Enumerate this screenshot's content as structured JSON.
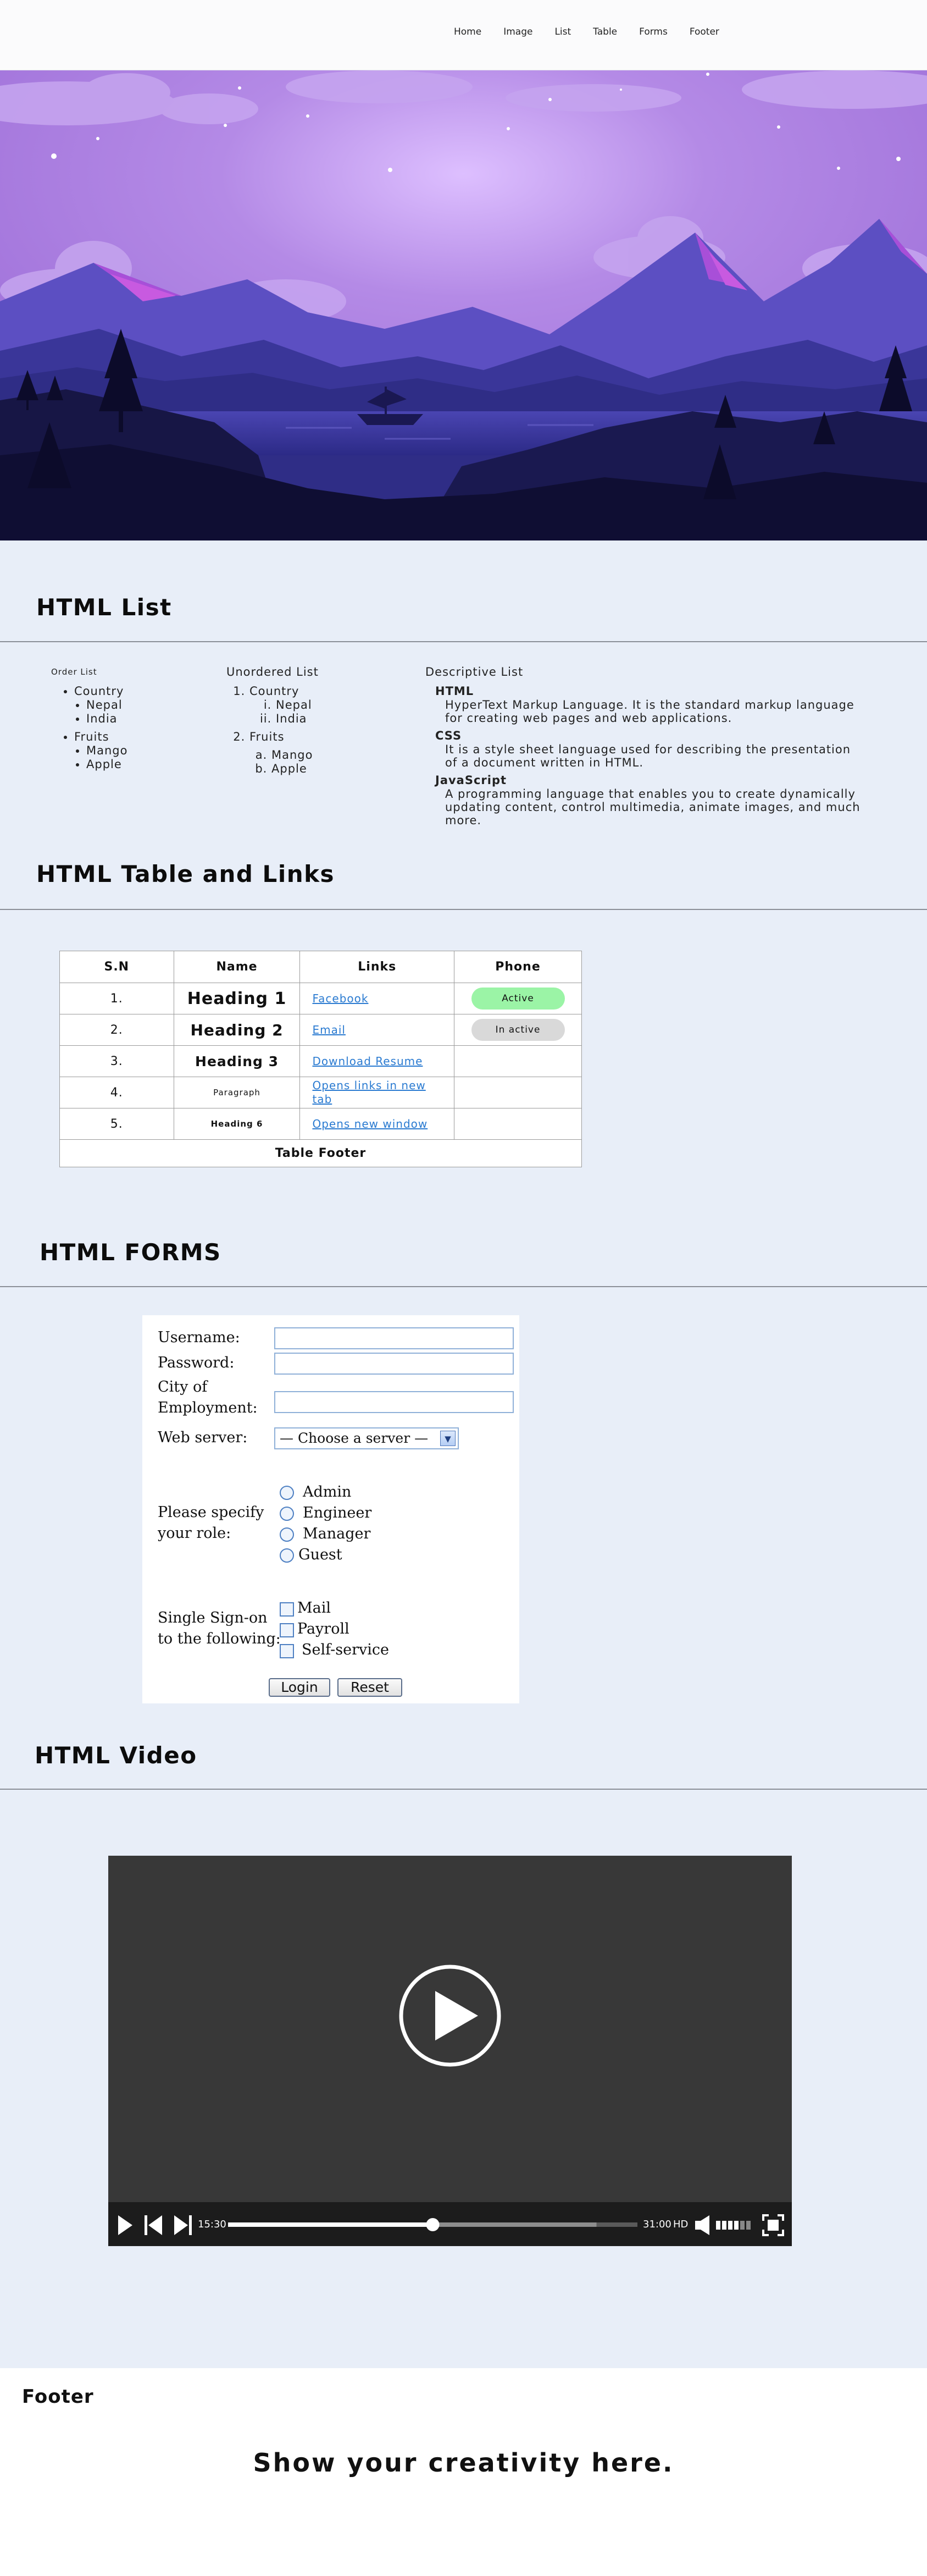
{
  "nav": {
    "items": [
      "Home",
      "Image",
      "List",
      "Table",
      "Forms",
      "Footer"
    ]
  },
  "list_section": {
    "title": "HTML List",
    "ordered": {
      "caption": "Order List",
      "items": [
        {
          "label": "Country",
          "children": [
            "Nepal",
            "India"
          ]
        },
        {
          "label": "Fruits",
          "children": [
            "Mango",
            "Apple"
          ]
        }
      ]
    },
    "unordered": {
      "caption": "Unordered List",
      "items": [
        {
          "label": "Country",
          "children": [
            "Nepal",
            "India"
          ]
        },
        {
          "label": "Fruits",
          "children": [
            "Mango",
            "Apple"
          ]
        }
      ]
    },
    "descriptive": {
      "caption": "Descriptive List",
      "items": [
        {
          "term": "HTML",
          "desc": "HyperText Markup Language. It is the standard markup language for creating web pages and web applications."
        },
        {
          "term": "CSS",
          "desc": "It is a style sheet language used for describing the presentation of a document written in HTML."
        },
        {
          "term": "JavaScript",
          "desc": "A programming language that enables you to create dynamically updating content, control multimedia, animate images, and much more."
        }
      ]
    }
  },
  "table_section": {
    "title": "HTML Table and Links",
    "headers": [
      "S.N",
      "Name",
      "Links",
      "Phone"
    ],
    "rows": [
      {
        "sn": "1.",
        "name": "Heading 1",
        "link": "Facebook",
        "status": "Active"
      },
      {
        "sn": "2.",
        "name": "Heading 2",
        "link": "Email",
        "status": "In active"
      },
      {
        "sn": "3.",
        "name": "Heading 3",
        "link": "Download Resume",
        "status": ""
      },
      {
        "sn": "4.",
        "name": "Paragraph",
        "link": "Opens links in new tab",
        "status": ""
      },
      {
        "sn": "5.",
        "name": "Heading 6",
        "link": "Opens new window",
        "status": ""
      }
    ],
    "footer": "Table Footer"
  },
  "form_section": {
    "title": "HTML FORMS",
    "username_label": "Username:",
    "password_label": "Password:",
    "city_label_1": "City of",
    "city_label_2": "Employment:",
    "server_label": "Web server:",
    "server_selected": "— Choose a server —",
    "role_label_1": "Please specify",
    "role_label_2": "your role:",
    "roles": [
      "Admin",
      "Engineer",
      "Manager",
      "Guest"
    ],
    "sso_label_1": "Single Sign-on",
    "sso_label_2": "to the following:",
    "sso_options": [
      "Mail",
      "Payroll",
      "Self-service"
    ],
    "login_label": "Login",
    "reset_label": "Reset"
  },
  "video_section": {
    "title": "HTML Video",
    "current_time": "15:30",
    "total_time": "31:00",
    "quality": "HD",
    "progress": 0.5,
    "buffered": 0.9
  },
  "footer": {
    "title": "Footer",
    "tagline": "Show your creativity here."
  },
  "colors": {
    "page_bg": "#e8eef8",
    "active_pill": "#9bf4a6",
    "inactive_pill": "#d9d9d9",
    "link": "#2b7bd1",
    "video_bg": "#383838"
  }
}
